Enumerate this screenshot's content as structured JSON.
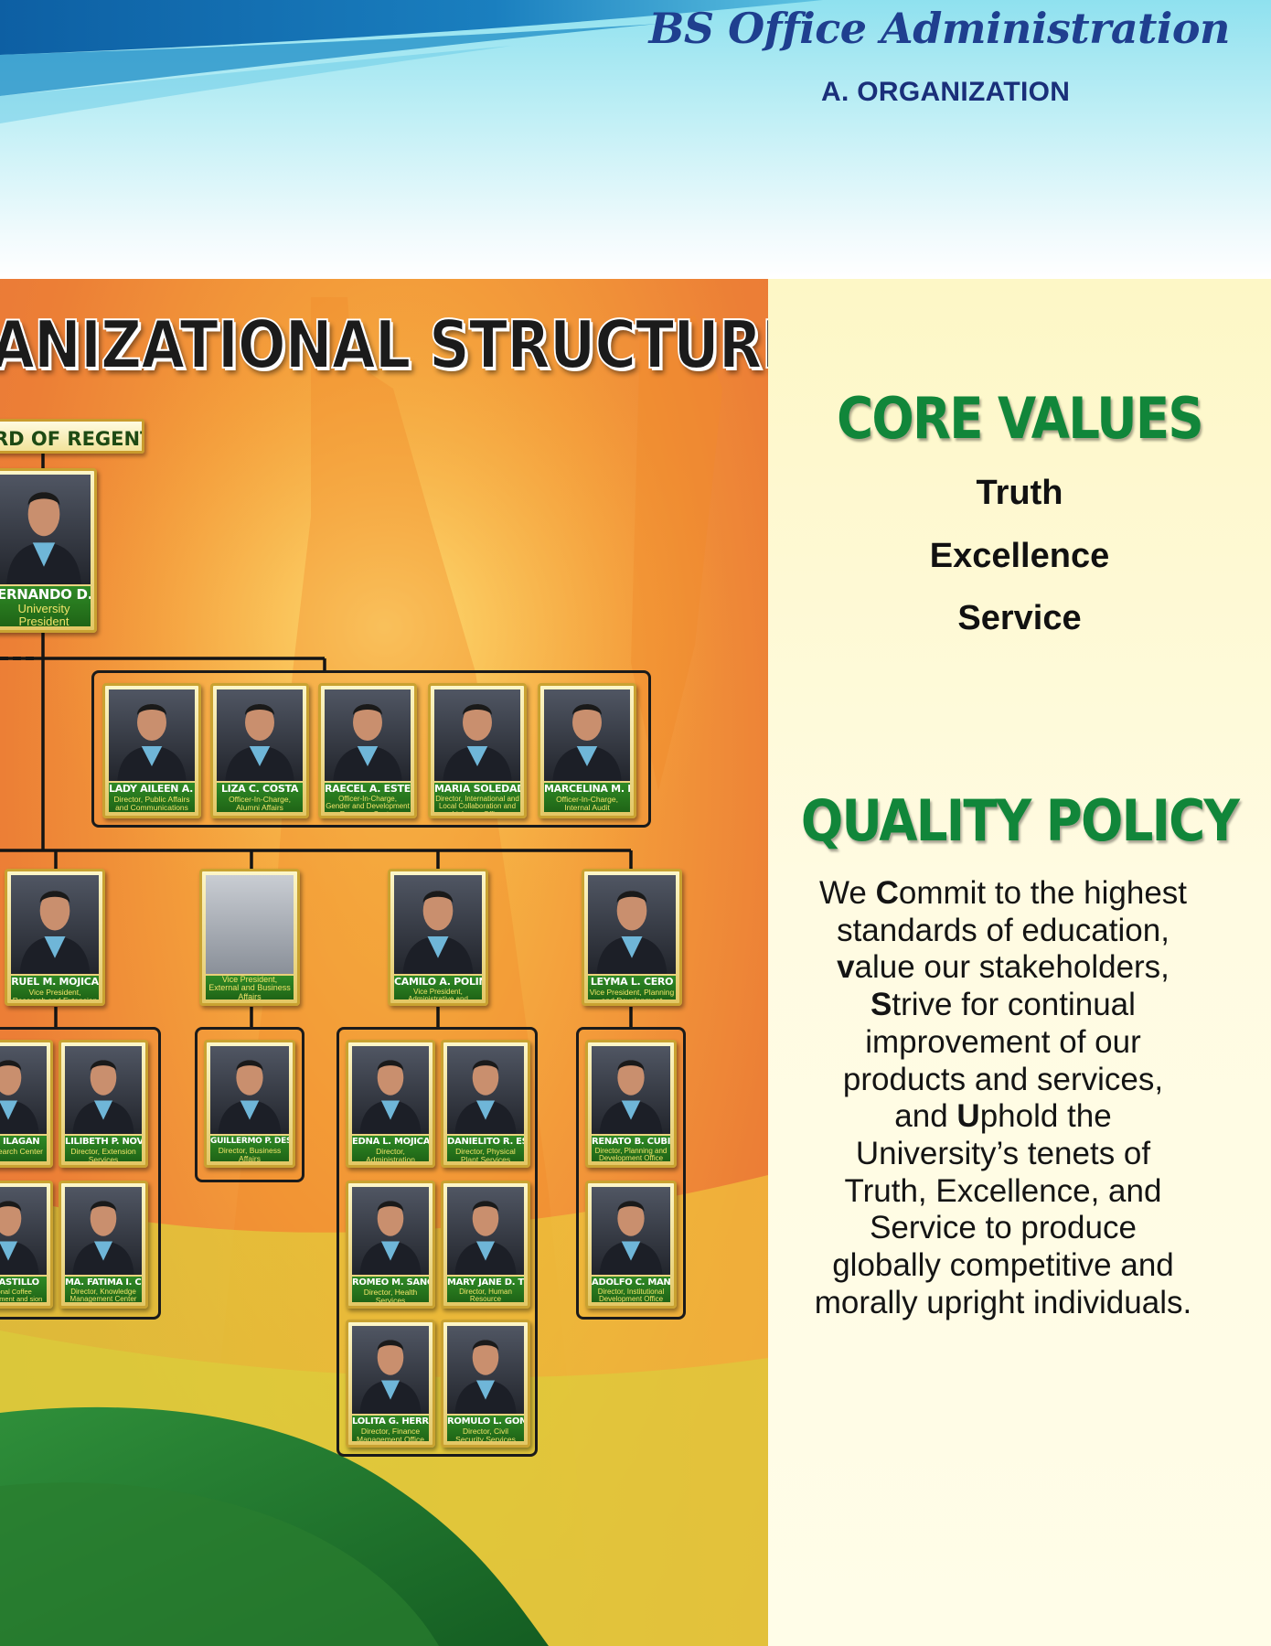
{
  "header": {
    "doc_title": "BS Office Administration",
    "section_heading": "A. ORGANIZATION"
  },
  "org_chart": {
    "title": "GANIZATIONAL STRUCTURE",
    "board_label": "RD OF REGENTS",
    "president": {
      "name": "ERNANDO D. ROBLES",
      "role": "University President"
    },
    "staff_row": [
      {
        "name": "LADY AILEEN A. ORSAL",
        "role": "Director, Public Affairs and Communications Office"
      },
      {
        "name": "LIZA C. COSTA",
        "role": "Officer-In-Charge, Alumni Affairs"
      },
      {
        "name": "RAECEL A. ESTEBAT",
        "role": "Officer-In-Charge, Gender and Development Resource Center"
      },
      {
        "name": "MARIA SOLEDAD M. LISING",
        "role": "Director, International and Local Collaboration and Linkages Office"
      },
      {
        "name": "MARCELINA M. MASICAP",
        "role": "Officer-In-Charge, Internal Audit"
      }
    ],
    "vice_presidents": [
      {
        "name": "RUEL M. MOJICA",
        "role": "Vice President, Research and Extension"
      },
      {
        "name": "",
        "role": "Vice President, External and Business Affairs"
      },
      {
        "name": "CAMILO A. POLINGA",
        "role": "Vice President, Administrative and Support Services"
      },
      {
        "name": "LEYMA L. CERO",
        "role": "Vice President, Planning and Development"
      }
    ],
    "research_group": [
      {
        "name": "IA A. ILAGAN",
        "role": "or, Research Center"
      },
      {
        "name": "LILIBETH P. NOVICIO",
        "role": "Director, Extension Services"
      },
      {
        "name": "M. CASTILLO",
        "role": "National Coffee Development and sion Center"
      },
      {
        "name": "MA. FATIMA I. CRUZADA",
        "role": "Director, Knowledge Management Center"
      }
    ],
    "business_group": [
      {
        "name": "GUILLERMO P. DESENGANIO",
        "role": "Director, Business Affairs"
      }
    ],
    "admin_group": [
      {
        "name": "EDNA L. MOJICA",
        "role": "Director, Administration"
      },
      {
        "name": "DANIELITO R. ESCAÑO",
        "role": "Director, Physical Plant Services"
      },
      {
        "name": "ROMEO M. SANCHEZ",
        "role": "Director, Health Services"
      },
      {
        "name": "MARY JANE D. TEPORA",
        "role": "Director, Human Resource Development Office"
      },
      {
        "name": "LOLITA G. HERRERA",
        "role": "Director, Finance Management Office"
      },
      {
        "name": "ROMULO L. GOMEZ",
        "role": "Director, Civil Security Services"
      }
    ],
    "planning_group": [
      {
        "name": "RENATO B. CUBILLA",
        "role": "Director, Planning and Development Office"
      },
      {
        "name": "ADOLFO C. MANUEL JR.",
        "role": "Director, Institutional Development Office"
      }
    ]
  },
  "core_values": {
    "title": "CORE VALUES",
    "items": [
      "Truth",
      "Excellence",
      "Service"
    ]
  },
  "quality_policy": {
    "title": "QUALITY POLICY",
    "parts": [
      "We ",
      "C",
      "ommit to the highest standards of education, ",
      "v",
      "alue our stakeholders, ",
      "S",
      "trive for continual improvement of our products and services, and ",
      "U",
      "phold the University’s tenets of Truth, Excellence, and Service to produce globally competitive and morally upright individuals."
    ]
  },
  "colors": {
    "header_blue": "#1f3f8f",
    "heading_navy": "#1a2f7a",
    "title_green": "#11863a",
    "poster_orange": "#ec7f36",
    "panel_cream": "#fdf7c6"
  }
}
